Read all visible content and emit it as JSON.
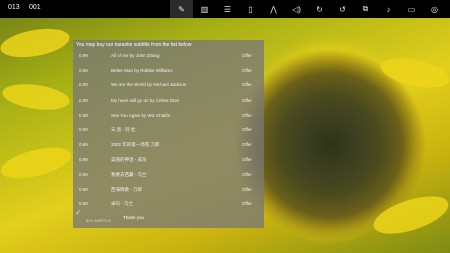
{
  "topbar": {
    "counter_left": "013",
    "counter_right": "001",
    "icons": [
      "edit-icon",
      "library-icon",
      "playlist-icon",
      "phone-icon",
      "audio-effect-icon",
      "volume-icon",
      "rotate-icon",
      "rewind-icon",
      "sliders-icon",
      "microphone-icon",
      "screen-icon",
      "globe-icon",
      "window-icon"
    ],
    "active_icon": "edit-icon"
  },
  "panel": {
    "heading": "You may buy our karaoke subtitle from the list below",
    "rows": [
      {
        "price": "0.99",
        "title": "All of me by John Zhang",
        "action": "Offer"
      },
      {
        "price": "0.99",
        "title": "Better Man by Robbie Williams",
        "action": "Offer"
      },
      {
        "price": "0.99",
        "title": "We are the World by Michael Jackson",
        "action": "Offer"
      },
      {
        "price": "0.99",
        "title": "My heart will go on by Celine Dion",
        "action": "Offer"
      },
      {
        "price": "0.99",
        "title": "See You Again by Wiz Khalifa",
        "action": "Offer"
      },
      {
        "price": "0.99",
        "title": "天 黑 - 阿 杜",
        "action": "Offer"
      },
      {
        "price": "0.99",
        "title": "2002 年的第一场雪 刀郎",
        "action": "Offer"
      },
      {
        "price": "0.99",
        "title": "美丽的神话 - 成龙",
        "action": "Offer"
      },
      {
        "price": "0.99",
        "title": "我要去西藏 - 乌兰",
        "action": "Offer"
      },
      {
        "price": "0.99",
        "title": "西海情歌 - 刀郎",
        "action": "Offer"
      },
      {
        "price": "0.99",
        "title": "卓玛 - 乌兰",
        "action": "Offer"
      }
    ],
    "buy_label": "BUY SUBTITLE",
    "thanks": "Thank you"
  }
}
